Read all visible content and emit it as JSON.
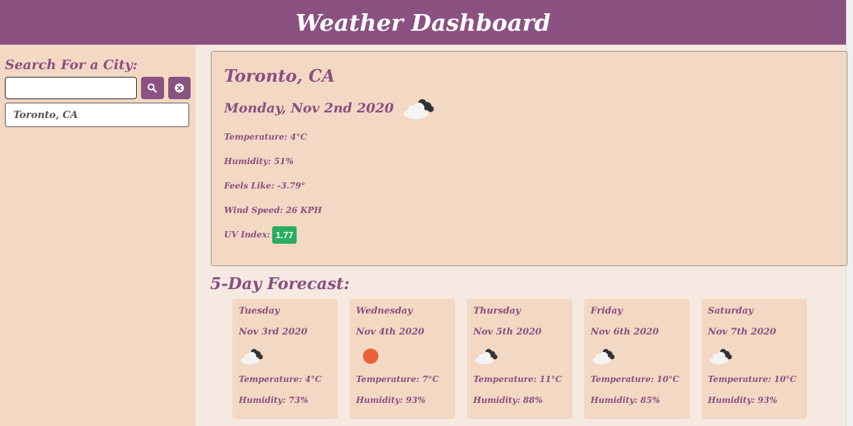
{
  "header": {
    "title": "Weather Dashboard"
  },
  "sidebar": {
    "heading": "Search For a City:",
    "search": {
      "value": "",
      "placeholder": ""
    },
    "search_button_icon": "search-icon",
    "clear_button_icon": "clear-icon",
    "history": [
      "Toronto, CA"
    ]
  },
  "current": {
    "city": "Toronto, CA",
    "date": "Monday, Nov 2nd 2020",
    "icon": "cloudy-icon",
    "temperature": "Temperature: 4°C",
    "humidity": "Humidity: 51%",
    "feels_like": "Feels Like: -3.79°",
    "wind_speed": "Wind Speed: 26 KPH",
    "uv_label": "UV Index:",
    "uv_value": "1.77"
  },
  "forecast": {
    "title": "5-Day Forecast:",
    "days": [
      {
        "day": "Tuesday",
        "date": "Nov 3rd 2020",
        "icon": "cloudy-icon",
        "temperature": "Temperature: 4°C",
        "humidity": "Humidity: 73%"
      },
      {
        "day": "Wednesday",
        "date": "Nov 4th 2020",
        "icon": "sun-icon",
        "temperature": "Temperature: 7°C",
        "humidity": "Humidity: 93%"
      },
      {
        "day": "Thursday",
        "date": "Nov 5th 2020",
        "icon": "cloudy-icon",
        "temperature": "Temperature: 11°C",
        "humidity": "Humidity: 88%"
      },
      {
        "day": "Friday",
        "date": "Nov 6th 2020",
        "icon": "cloudy-icon",
        "temperature": "Temperature: 10°C",
        "humidity": "Humidity: 85%"
      },
      {
        "day": "Saturday",
        "date": "Nov 7th 2020",
        "icon": "cloudy-icon",
        "temperature": "Temperature: 10°C",
        "humidity": "Humidity: 93%"
      }
    ]
  },
  "colors": {
    "header_bg": "#8b5181",
    "panel_bg": "#f3d8c4",
    "page_bg": "#f5e9e1",
    "text": "#8b4f80",
    "uv_badge": "#27ae60"
  }
}
